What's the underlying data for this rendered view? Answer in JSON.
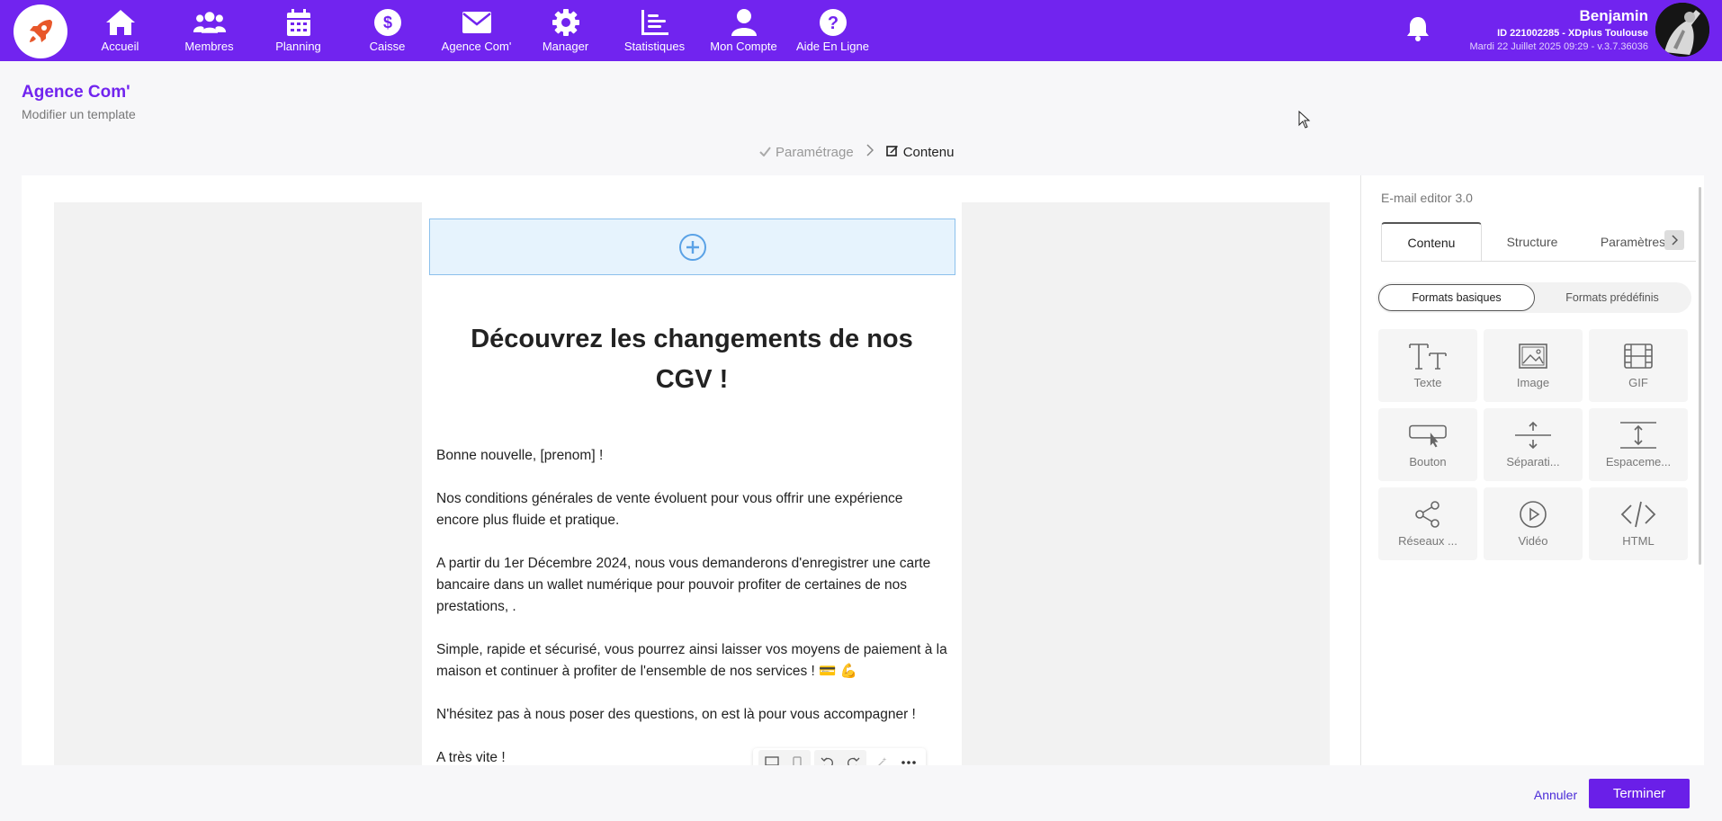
{
  "brand": {
    "accent": "#7124ef",
    "logo_color": "#e8572a"
  },
  "nav": {
    "items": [
      {
        "label": "Accueil",
        "icon": "home-icon"
      },
      {
        "label": "Membres",
        "icon": "users-icon"
      },
      {
        "label": "Planning",
        "icon": "calendar-icon"
      },
      {
        "label": "Caisse",
        "icon": "dollar-icon"
      },
      {
        "label": "Agence Com'",
        "icon": "envelope-icon"
      },
      {
        "label": "Manager",
        "icon": "gear-icon"
      },
      {
        "label": "Statistiques",
        "icon": "chart-icon"
      },
      {
        "label": "Mon Compte",
        "icon": "user-icon"
      },
      {
        "label": "Aide En Ligne",
        "icon": "help-icon"
      }
    ]
  },
  "user": {
    "name": "Benjamin",
    "id_line": "ID 221002285 - XDplus Toulouse",
    "date_line": "Mardi 22 Juillet 2025 09:29 - v.3.7.36036"
  },
  "page": {
    "title": "Agence Com'",
    "subtitle": "Modifier un template"
  },
  "steps": {
    "done": "Paramétrage",
    "active": "Contenu"
  },
  "email": {
    "headline": "Découvrez les changements de nos CGV !",
    "paragraphs": [
      "Bonne nouvelle, [prenom] !",
      "Nos conditions générales de vente évoluent pour vous offrir une expérience encore plus fluide et pratique.",
      "A partir du 1er  Décembre 2024, nous vous demanderons d'enregistrer une carte bancaire dans un wallet numérique pour pouvoir profiter de certaines de nos prestations, .",
      "Simple, rapide et sécurisé, vous pourrez ainsi laisser vos moyens de paiement à la maison et continuer à profiter de l'ensemble de nos services ! 💳 💪",
      "N'hésitez pas à nous poser des questions, on est là pour vous accompagner !",
      "A très vite !"
    ]
  },
  "panel": {
    "title": "E-mail editor 3.0",
    "tabs": [
      "Contenu",
      "Structure",
      "Paramètres"
    ],
    "segments": [
      "Formats basiques",
      "Formats prédéfinis"
    ],
    "blocks": [
      {
        "label": "Texte",
        "icon": "text-icon"
      },
      {
        "label": "Image",
        "icon": "image-icon"
      },
      {
        "label": "GIF",
        "icon": "film-icon"
      },
      {
        "label": "Bouton",
        "icon": "button-icon"
      },
      {
        "label": "Séparati...",
        "icon": "divider-icon"
      },
      {
        "label": "Espaceme...",
        "icon": "spacer-icon"
      },
      {
        "label": "Réseaux ...",
        "icon": "share-icon"
      },
      {
        "label": "Vidéo",
        "icon": "play-icon"
      },
      {
        "label": "HTML",
        "icon": "code-icon"
      }
    ]
  },
  "footer": {
    "cancel": "Annuler",
    "finish": "Terminer"
  }
}
